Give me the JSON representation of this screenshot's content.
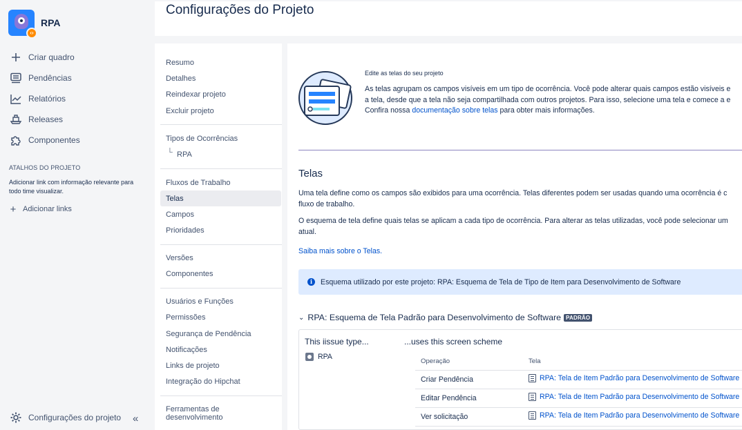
{
  "project": {
    "name": "RPA"
  },
  "sidebar": {
    "items": [
      {
        "label": "Criar quadro",
        "icon": "plus-icon"
      },
      {
        "label": "Pendências",
        "icon": "backlog-icon"
      },
      {
        "label": "Relatórios",
        "icon": "reports-icon"
      },
      {
        "label": "Releases",
        "icon": "ship-icon"
      },
      {
        "label": "Componentes",
        "icon": "puzzle-icon"
      }
    ],
    "shortcuts_title": "ATALHOS DO PROJETO",
    "shortcuts_desc": "Adicionar link com informação relevante para todo time visualizar.",
    "add_links": "Adicionar links",
    "footer_label": "Configurações do projeto",
    "collapse_glyph": "«"
  },
  "page": {
    "title": "Configurações do Projeto"
  },
  "settings_nav": {
    "items": [
      "Resumo",
      "Detalhes",
      "Reindexar projeto",
      "Excluir projeto",
      "Tipos de Ocorrências",
      "RPA",
      "Fluxos de Trabalho",
      "Telas",
      "Campos",
      "Prioridades",
      "Versões",
      "Componentes",
      "Usuários e Funções",
      "Permissões",
      "Segurança de Pendência",
      "Notificações",
      "Links de projeto",
      "Integração do Hipchat",
      "Ferramentas de desenvolvimento"
    ],
    "active": "Telas"
  },
  "main": {
    "intro_heading": "Edite as telas do seu projeto",
    "intro_line1": "As telas agrupam os campos visíveis em um tipo de ocorrência. Você pode alterar quais campos estão visíveis e",
    "intro_line2": "a tela, desde que a tela não seja compartilhada com outros projetos. Para isso, selecione uma tela e comece a e",
    "intro_line3_prefix": "Confira nossa ",
    "intro_link": "documentação sobre telas",
    "intro_line3_suffix": " para obter mais informações.",
    "section_title": "Telas",
    "para1_line1": "Uma tela define como os campos são exibidos para uma ocorrência. Telas diferentes podem ser usadas quando uma ocorrência é c",
    "para1_line2": "fluxo de trabalho.",
    "para2_line1": "O esquema de tela define quais telas se aplicam a cada tipo de ocorrência. Para alterar as telas utilizadas, você pode selecionar um",
    "para2_line2": "atual.",
    "learn_more": "Saiba mais sobre o Telas.",
    "info_text": "Esquema utilizado por este projeto: RPA: Esquema de Tela de Tipo de Item para Desenvolvimento de Software",
    "scheme_title": "RPA: Esquema de Tela Padrão para Desenvolvimento de Software",
    "scheme_badge": "PADRÃO",
    "col_left_title": "This iissue type...",
    "col_right_title": "...uses this screen scheme",
    "issue_type": "RPA",
    "table_headers": [
      "Operação",
      "Tela"
    ],
    "table_rows": [
      {
        "op": "Criar Pendência",
        "screen": "RPA: Tela de Item Padrão para Desenvolvimento de Software"
      },
      {
        "op": "Editar Pendência",
        "screen": "RPA: Tela de Item Padrão para Desenvolvimento de Software"
      },
      {
        "op": "Ver solicitação",
        "screen": "RPA: Tela de Item Padrão para Desenvolvimento de Software"
      }
    ]
  }
}
